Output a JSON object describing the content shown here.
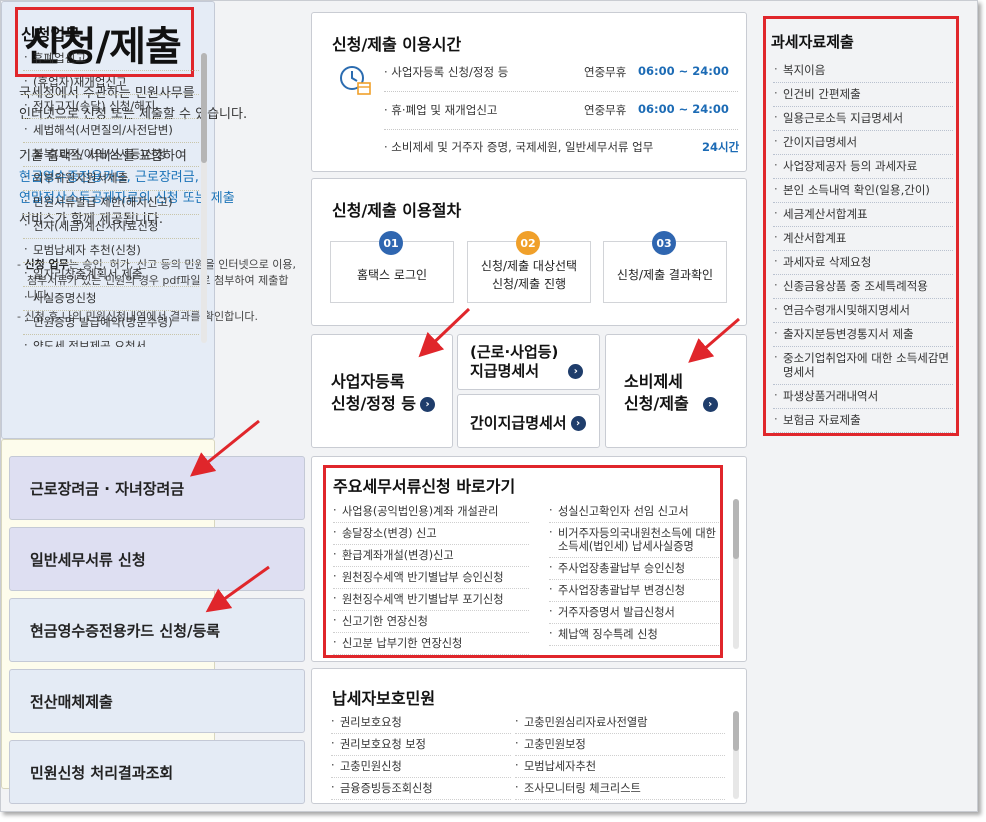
{
  "title": "신청/제출",
  "intro": {
    "line1": "국세청에서 주관하는 민원사무를",
    "line2": "인터넷으로 신청 또는 제출할 수 있습니다.",
    "line3": "기존 홈택스 서비스를 포함하여",
    "line4_blue": "현금영수증전용카드, 근로장려금,",
    "line5_blue": "연말정산소득공제자료의 신청 또는 제출",
    "line6": "서비스가 함께 제공됩니다.",
    "note1_bold": "신청 업무",
    "note1_rest": "는 승인, 허가, 신고 등의 민원을 인터넷으로 이용, 첨부서류가 있는 민원의 경우 pdf파일로 첨부하여 제출합니다.",
    "note2": "신청 후 나의 민원신청내역에서 결과를 확인합니다.",
    "note_dash": "-"
  },
  "left_nav": [
    {
      "label": "근로장려금 · 자녀장려금"
    },
    {
      "label": "일반세무서류 신청"
    },
    {
      "label": "현금영수증전용카드 신청/등록"
    },
    {
      "label": "전산매체제출"
    },
    {
      "label": "민원신청 처리결과조회"
    }
  ],
  "usage_time": {
    "title": "신청/제출 이용시간",
    "rows": [
      {
        "label": "· 사업자등록 신청/정정 등",
        "fee": "연중무휴",
        "hours": "06:00 ~ 24:00"
      },
      {
        "label": "· 휴·폐업 및 재개업신고",
        "fee": "연중무휴",
        "hours": "06:00 ~ 24:00"
      },
      {
        "label": "· 소비제세 및 거주자 증명, 국제세원, 일반세무서류 업무",
        "fee": "",
        "hours": "24시간"
      }
    ]
  },
  "procedure": {
    "title": "신청/제출 이용절차",
    "steps": [
      {
        "num": "01",
        "line1": "홈택스 로그인",
        "line2": ""
      },
      {
        "num": "02",
        "line1": "신청/제출 대상선택",
        "line2": "신청/제출 진행"
      },
      {
        "num": "03",
        "line1": "신청/제출 결과확인",
        "line2": ""
      }
    ],
    "colors": {
      "step1": "#2f66b0",
      "step2": "#f0a02a",
      "step3": "#2f66b0"
    }
  },
  "services": {
    "biz_reg_line1": "사업자등록",
    "biz_reg_line2": "신청/정정 등",
    "wage_line1": "(근로·사업등)",
    "wage_line2": "지급명세서",
    "simple_wage": "간이지급명세서",
    "consumption_line1": "소비제세",
    "consumption_line2": "신청/제출",
    "go_icon": "›"
  },
  "tax_data": {
    "title": "과세자료제출",
    "items": [
      "복지이음",
      "인건비 간편제출",
      "일용근로소득 지급명세서",
      "간이지급명세서",
      "사업장제공자 등의 과세자료",
      "본인 소득내역 확인(일용,간이)",
      "세금계산서합계표",
      "계산서합계표",
      "과세자료 삭제요청",
      "신종금융상품 중 조세특례적용",
      "연금수령개시및해지명세서",
      "출자지분등변경통지서 제출",
      "중소기업취업자에 대한 소득세감면명세서",
      "파생상품거래내역서",
      "보험금 자료제출"
    ]
  },
  "major_docs": {
    "title": "주요세무서류신청 바로가기",
    "left": [
      "사업용(공익법인용)계좌 개설관리",
      "송달장소(변경) 신고",
      "환급계좌개설(변경)신고",
      "원천징수세액 반기별납부 승인신청",
      "원천징수세액 반기별납부 포기신청",
      "신고기한 연장신청",
      "신고분 납부기한 연장신청"
    ],
    "right": [
      "성실신고확인자 선임 신고서",
      "비거주자등의국내원천소득에 대한 소득세(법인세) 납세사실증명",
      "주사업장총괄납부 승인신청",
      "주사업장총괄납부 변경신청",
      "거주자증명서 발급신청서",
      "체납액 징수특례 신청"
    ]
  },
  "protect": {
    "title": "납세자보호민원",
    "left": [
      "권리보호요청",
      "권리보호요청 보정",
      "고충민원신청",
      "금융증빙등조회신청"
    ],
    "right": [
      "고충민원심리자료사전열람",
      "고충민원보정",
      "모범납세자추천",
      "조사모니터링 체크리스트"
    ]
  },
  "apply": {
    "title": "신청업무",
    "items": [
      "휴폐업신고",
      "(휴업자)재개업신고",
      "전자고지(송달) 신청/해지",
      "세법해석(서면질의/사전답변)",
      "불복(과적/이의/심사등)신청",
      "외부위원지원서제출",
      "민원서류발급 제한(해지신고)",
      "전자(세금)계산서자료신청",
      "모범납세자 추천(신청)",
      "일자리창출계획서 제출",
      "사실증명신청",
      "민원증명 발급예약(방문수령)",
      "양도세 정보제공 요청서"
    ]
  },
  "colors": {
    "highlight_red": "#e0262b",
    "link_blue": "#1c74b8",
    "go_navy": "#1f3d6b"
  }
}
